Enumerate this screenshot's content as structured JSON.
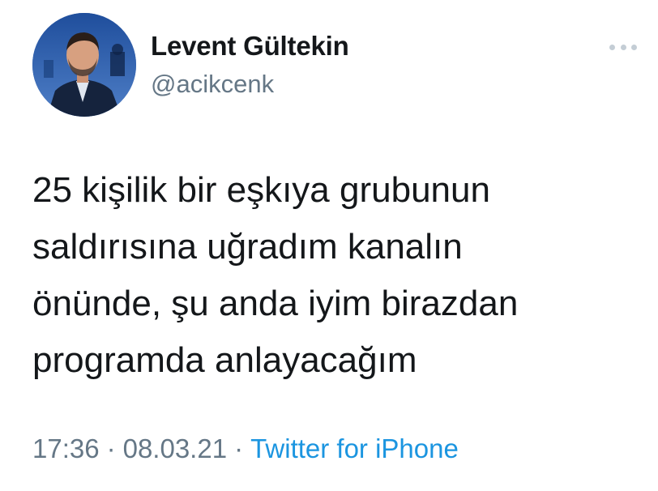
{
  "author": {
    "display_name": "Levent Gültekin",
    "handle": "@acikcenk"
  },
  "tweet": {
    "text_lines": [
      "25 kişilik bir eşkıya grubunun",
      "saldırısına uğradım kanalın",
      "önünde, şu anda iyim birazdan",
      "programda anlayacağım"
    ],
    "time": "17:36",
    "date": "08.03.21",
    "separator": "·",
    "source": "Twitter for iPhone"
  },
  "colors": {
    "text": "#14171a",
    "secondary": "#657786",
    "link": "#1b95e0",
    "more_dots": "#c4cdd5"
  },
  "icons": {
    "more": "more-horizontal-icon"
  }
}
